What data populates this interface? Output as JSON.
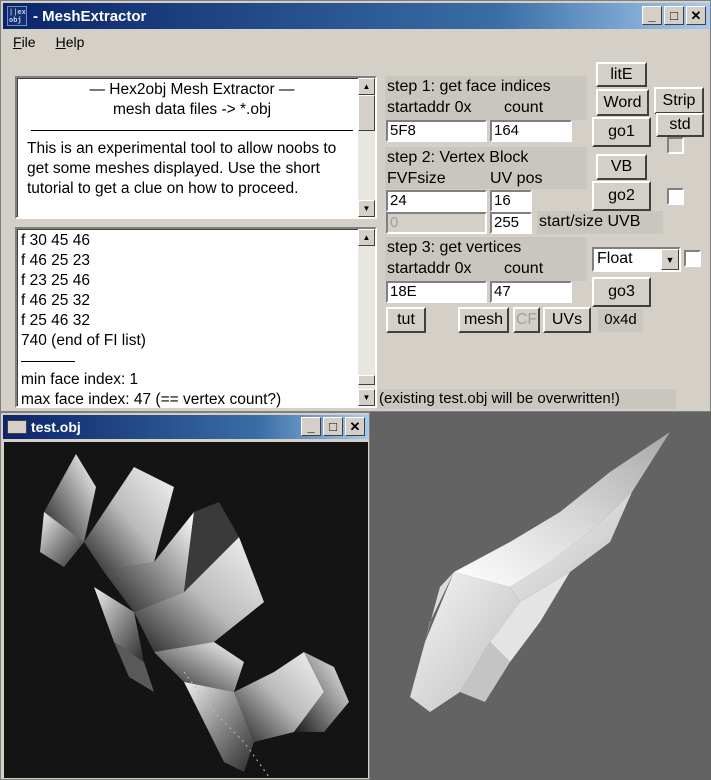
{
  "app": {
    "title": "MeshExtractor",
    "icon_text": "||ex obj"
  },
  "title_buttons": {
    "minimize": "_",
    "maximize": "□",
    "close": "✕"
  },
  "menu": [
    {
      "label": "File",
      "key": "F",
      "rest": "ile"
    },
    {
      "label": "Help",
      "key": "H",
      "rest": "elp"
    }
  ],
  "info": {
    "line1": "—   Hex2obj Mesh Extractor   —",
    "line2": "mesh data files -> *.obj",
    "body": "This is an experimental tool to allow noobs to get some meshes displayed. Use the short tutorial to get a clue on how to proceed."
  },
  "log": {
    "lines": [
      "f  30 45 46",
      "f  46 25 23",
      "f  23 25 46",
      "f  46 25 32",
      "f  25 46 32",
      "740 (end of FI list)"
    ],
    "after": [
      "min face index: 1",
      "max face index: 47 (== vertex count?)"
    ]
  },
  "step1": {
    "title": "step 1: get face indices",
    "addr_label": "startaddr 0x",
    "count_label": "count",
    "addr_value": "5F8",
    "count_value": "164"
  },
  "step2": {
    "title": "step 2: Vertex Block",
    "fvf_label": "FVFsize",
    "uv_label": "UV pos",
    "fvf_value": "24",
    "uv_value": "16",
    "uvb_start": "0",
    "uvb_size": "255",
    "uvb_label": "start/size UVB"
  },
  "step3": {
    "title": "step 3: get vertices",
    "addr_label": "startaddr 0x",
    "count_label": "count",
    "addr_value": "18E",
    "count_value": "47"
  },
  "buttons": {
    "litE": "litE",
    "word": "Word",
    "strip": "Strip",
    "std": "std",
    "go1": "go1",
    "vb": "VB",
    "go2": "go2",
    "go3": "go3",
    "tut": "tut",
    "mesh": "mesh",
    "cf": "CF",
    "uvs": "UVs",
    "hex": "0x4d"
  },
  "format_select": {
    "value": "Float"
  },
  "status": "(existing test.obj will be overwritten!)",
  "gl_window": {
    "title": "test.obj"
  },
  "colors": {
    "titlebar_start": "#0a246a",
    "face": "#d4d0c8",
    "viewport_bg": "#141414",
    "right_bg": "#636363"
  }
}
